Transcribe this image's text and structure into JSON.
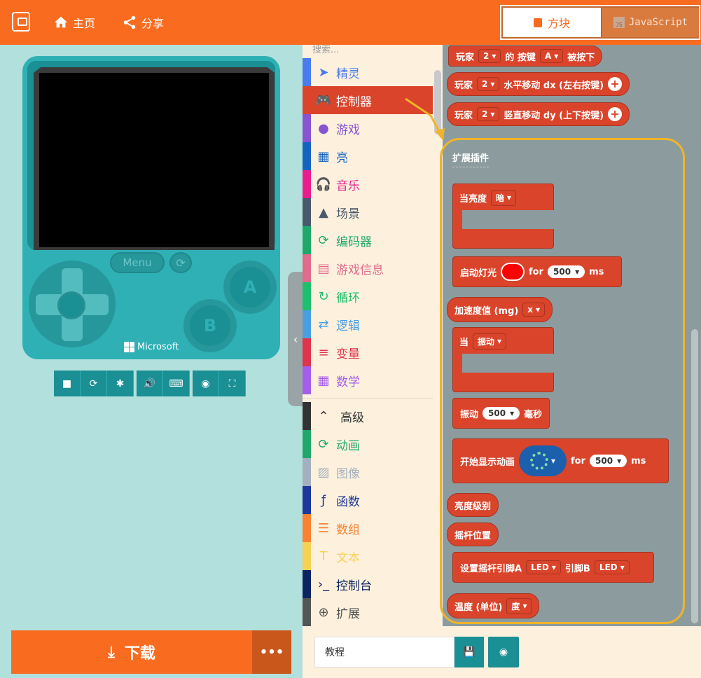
{
  "header": {
    "home_label": "主页",
    "share_label": "分享",
    "tab_blocks": "方块",
    "tab_js": "JavaScript",
    "js_badge": "JS",
    "accent_color": "#f96c20"
  },
  "simulator": {
    "menu_label": "Menu",
    "button_a": "A",
    "button_b": "B",
    "brand": "Microsoft",
    "toolbar_icons": [
      "stop-icon",
      "restart-icon",
      "debug-icon",
      "sound-icon",
      "keyboard-icon",
      "screenshot-icon",
      "fullscreen-icon"
    ]
  },
  "download": {
    "label": "下载",
    "more_label": "•••"
  },
  "toolbox": {
    "search_placeholder": "搜索...",
    "categories": [
      {
        "label": "精灵",
        "color": "#4b7bec",
        "icon": "paper-plane-icon"
      },
      {
        "label": "控制器",
        "color": "#d9442b",
        "icon": "gamepad-icon"
      },
      {
        "label": "游戏",
        "color": "#8854d0",
        "icon": "circle-icon"
      },
      {
        "label": "亮",
        "color": "#1565c0",
        "icon": "grid-icon"
      },
      {
        "label": "音乐",
        "color": "#e91e8c",
        "icon": "headphones-icon"
      },
      {
        "label": "场景",
        "color": "#4a5a6b",
        "icon": "tree-icon"
      },
      {
        "label": "编码器",
        "color": "#20a86b",
        "icon": "refresh-icon"
      },
      {
        "label": "游戏信息",
        "color": "#e06b8b",
        "icon": "id-card-icon"
      },
      {
        "label": "循环",
        "color": "#20bf6b",
        "icon": "loop-icon"
      },
      {
        "label": "逻辑",
        "color": "#4b9fe1",
        "icon": "shuffle-icon"
      },
      {
        "label": "变量",
        "color": "#e0344b",
        "icon": "list-icon"
      },
      {
        "label": "数学",
        "color": "#a55eea",
        "icon": "calculator-icon"
      },
      {
        "label": "高级",
        "color": "#333333",
        "icon": "chevron-up-icon"
      },
      {
        "label": "动画",
        "color": "#20a86b",
        "icon": "refresh-icon"
      },
      {
        "label": "图像",
        "color": "#a4b0be",
        "icon": "image-icon"
      },
      {
        "label": "函数",
        "color": "#1e3799",
        "icon": "function-icon"
      },
      {
        "label": "数组",
        "color": "#fa8231",
        "icon": "list-ol-icon"
      },
      {
        "label": "文本",
        "color": "#f7d154",
        "icon": "text-icon"
      },
      {
        "label": "控制台",
        "color": "#0c2461",
        "icon": "terminal-icon"
      },
      {
        "label": "扩展",
        "color": "#555555",
        "icon": "plus-circle-icon"
      }
    ]
  },
  "workspace": {
    "top_blocks": [
      {
        "player": "玩家",
        "num": "2",
        "text1": "的 按键",
        "key": "A",
        "text2": "被按下"
      },
      {
        "player": "玩家",
        "num": "2",
        "text": "水平移动 dx (左右按键)"
      },
      {
        "player": "玩家",
        "num": "2",
        "text": "竖直移动 dy (上下按键)"
      }
    ],
    "ext_title": "扩展插件",
    "blocks": {
      "brightness_when": "当亮度",
      "brightness_opt": "暗",
      "light_start": "启动灯光",
      "light_for": "for",
      "light_ms_val": "500",
      "light_ms": "ms",
      "accel": "加速度值 (mg)",
      "accel_axis": "x",
      "when_label": "当",
      "when_opt": "振动",
      "vibrate": "振动",
      "vibrate_val": "500",
      "vibrate_unit": "毫秒",
      "anim_start": "开始显示动画",
      "anim_for": "for",
      "anim_val": "500",
      "anim_ms": "ms",
      "brightness_level": "亮度级别",
      "joystick_pos": "摇杆位置",
      "set_pin": "设置摇杆引脚A",
      "pin_a": "LED",
      "pin_b_label": "引脚B",
      "pin_b": "LED",
      "temp": "温度 (单位)",
      "temp_unit": "度"
    }
  },
  "project": {
    "name": "教程"
  }
}
